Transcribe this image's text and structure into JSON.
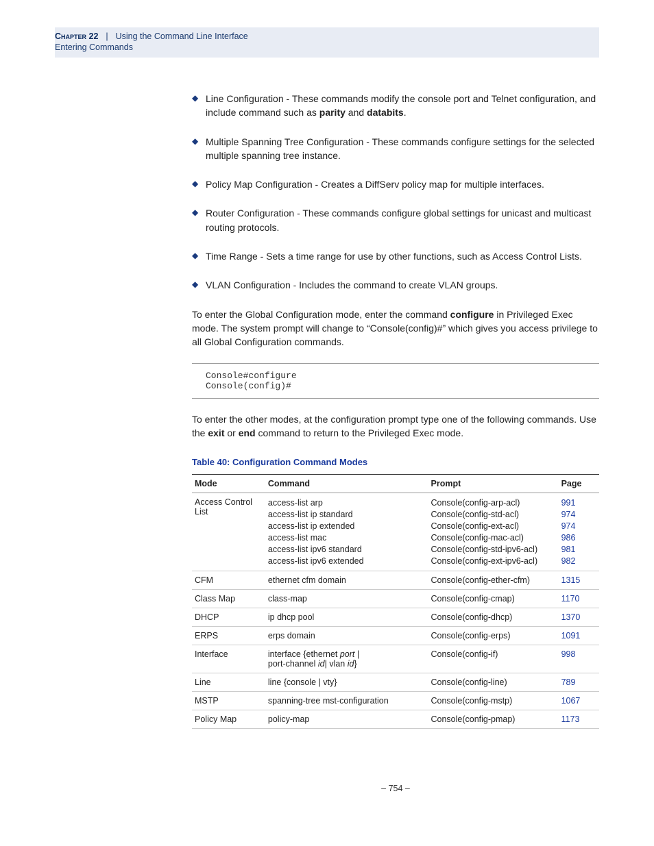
{
  "header": {
    "chapter_label": "Chapter 22",
    "chapter_title": "Using the Command Line Interface",
    "section": "Entering Commands"
  },
  "bullets": [
    {
      "pre": "Line Configuration - These commands modify the console port and Telnet configuration, and include command such as ",
      "b1": "parity",
      "mid": " and ",
      "b2": "databits",
      "post": "."
    },
    {
      "text": "Multiple Spanning Tree Configuration - These commands configure settings for the selected multiple spanning tree instance."
    },
    {
      "text": "Policy Map Configuration - Creates a DiffServ policy map for multiple interfaces."
    },
    {
      "text": "Router Configuration - These commands configure global settings for unicast and multicast routing protocols."
    },
    {
      "text": "Time Range - Sets a time range for use by other functions, such as Access Control Lists."
    },
    {
      "text": "VLAN Configuration - Includes the command to create VLAN groups."
    }
  ],
  "para1": {
    "pre": "To enter the Global Configuration mode, enter the command ",
    "b1": "configure",
    "post": " in Privileged Exec mode. The system prompt will change to “Console(config)#” which gives you access privilege to all Global Configuration commands."
  },
  "code": "Console#configure\nConsole(config)#",
  "para2": {
    "pre": "To enter the other modes, at the configuration prompt type one of the following commands. Use the ",
    "b1": "exit",
    "mid": " or ",
    "b2": "end",
    "post": " command to return to the Privileged Exec mode."
  },
  "table": {
    "title": "Table 40: Configuration Command Modes",
    "headers": {
      "mode": "Mode",
      "command": "Command",
      "prompt": "Prompt",
      "page": "Page"
    },
    "rows": [
      {
        "mode": "Access Control List",
        "command_lines": [
          "access-list arp",
          "access-list ip standard",
          "access-list ip extended",
          "access-list mac",
          "access-list ipv6 standard",
          "access-list ipv6 extended"
        ],
        "prompt_lines": [
          "Console(config-arp-acl)",
          "Console(config-std-acl)",
          "Console(config-ext-acl)",
          "Console(config-mac-acl)",
          "Console(config-std-ipv6-acl)",
          "Console(config-ext-ipv6-acl)"
        ],
        "page_lines": [
          "991",
          "974",
          "974",
          "986",
          "981",
          "982"
        ]
      },
      {
        "mode": "CFM",
        "command": "ethernet cfm domain",
        "prompt": "Console(config-ether-cfm)",
        "page": "1315"
      },
      {
        "mode": "Class Map",
        "command": "class-map",
        "prompt": "Console(config-cmap)",
        "page": "1170"
      },
      {
        "mode": "DHCP",
        "command": "ip dhcp pool",
        "prompt": "Console(config-dhcp)",
        "page": "1370"
      },
      {
        "mode": "ERPS",
        "command": "erps domain",
        "prompt": "Console(config-erps)",
        "page": "1091"
      },
      {
        "mode": "Interface",
        "command_complex": {
          "l1_pre": "interface {ethernet ",
          "l1_it": "port",
          "l1_post": " |",
          "l2_pre": "  port-channel ",
          "l2_it1": "id",
          "l2_mid": "| vlan ",
          "l2_it2": "id",
          "l2_post": "}"
        },
        "prompt": "Console(config-if)",
        "page": "998"
      },
      {
        "mode": "Line",
        "command": "line {console | vty}",
        "prompt": "Console(config-line)",
        "page": "789"
      },
      {
        "mode": "MSTP",
        "command": "spanning-tree mst-configuration",
        "prompt": "Console(config-mstp)",
        "page": "1067"
      },
      {
        "mode": "Policy Map",
        "command": "policy-map",
        "prompt": "Console(config-pmap)",
        "page": "1173"
      }
    ]
  },
  "page_number": "–  754  –"
}
